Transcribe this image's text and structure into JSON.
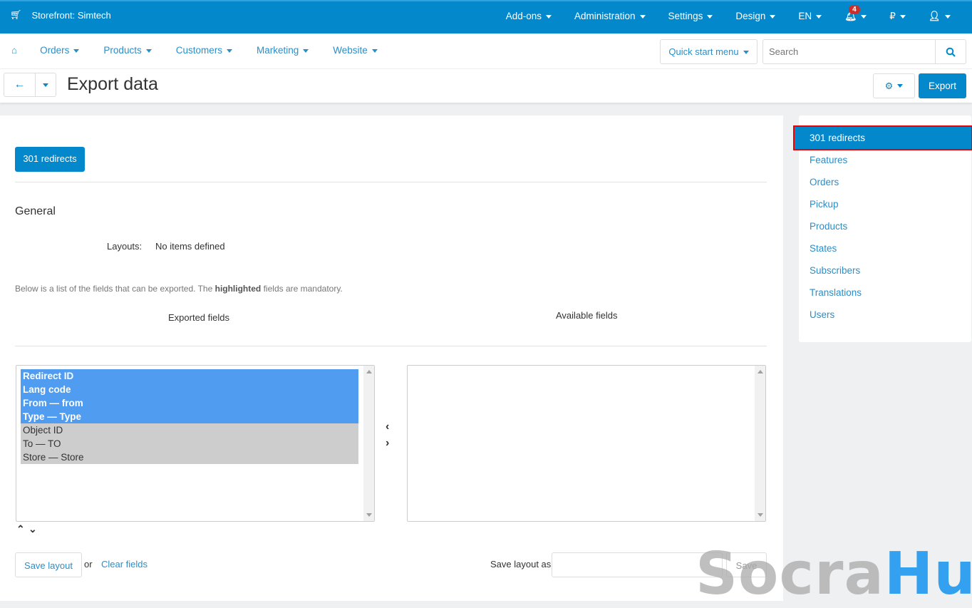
{
  "topbar": {
    "storefront": "Storefront: Simtech",
    "menu": [
      "Add-ons",
      "Administration",
      "Settings",
      "Design",
      "EN"
    ],
    "notifications": "4",
    "currency": "₽"
  },
  "nav": {
    "items": [
      "Orders",
      "Products",
      "Customers",
      "Marketing",
      "Website"
    ],
    "quick_start": "Quick start menu",
    "search_placeholder": "Search"
  },
  "header": {
    "title": "Export data",
    "export": "Export"
  },
  "main": {
    "tab": "301 redirects",
    "section": "General",
    "layouts_label": "Layouts:",
    "layouts_value": "No items defined",
    "note_pre": "Below is a list of the fields that can be exported. The ",
    "note_bold": "highlighted",
    "note_post": " fields are mandatory.",
    "exported_title": "Exported fields",
    "available_title": "Available fields",
    "exported_fields": [
      {
        "label": "Redirect ID",
        "mandatory": true
      },
      {
        "label": "Lang code",
        "mandatory": true
      },
      {
        "label": "From — from",
        "mandatory": true
      },
      {
        "label": "Type — Type",
        "mandatory": true
      },
      {
        "label": "Object ID",
        "mandatory": false
      },
      {
        "label": "To — TO",
        "mandatory": false
      },
      {
        "label": "Store — Store",
        "mandatory": false
      }
    ],
    "save_layout": "Save layout",
    "or": "or",
    "clear_fields": "Clear fields",
    "save_layout_as": "Save layout as:",
    "save": "Save"
  },
  "sidebar": {
    "items": [
      "301 redirects",
      "Features",
      "Orders",
      "Pickup",
      "Products",
      "States",
      "Subscribers",
      "Translations",
      "Users"
    ],
    "active": 0
  },
  "watermark": {
    "part1": "Socra",
    "part2": "Hub"
  },
  "colors": {
    "primary": "#0388cc",
    "highlight": "#509cf0",
    "active_outline": "#e00000"
  }
}
